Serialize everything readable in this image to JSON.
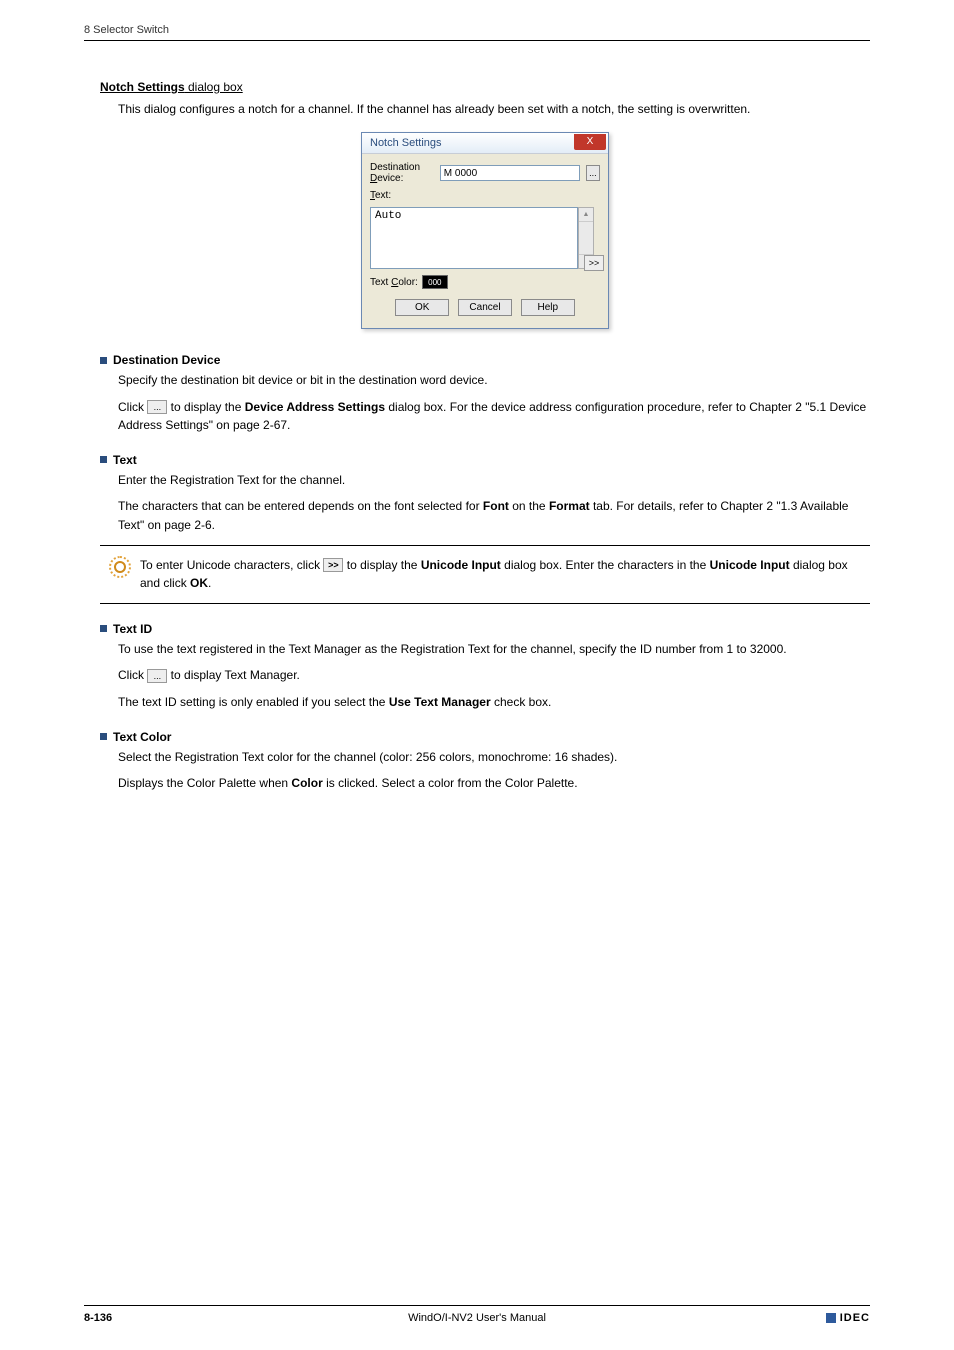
{
  "header": {
    "chapter": "8 Selector Switch"
  },
  "main_heading": {
    "bold": "Notch Settings",
    "rest": " dialog box"
  },
  "intro": "This dialog configures a notch for a channel. If the channel has already been set with a notch, the setting is overwritten.",
  "dialog": {
    "title": "Notch Settings",
    "close": "X",
    "dest_label_pre": "Destination ",
    "dest_label_uline": "D",
    "dest_label_post": "evice:",
    "dest_value": "M 0000",
    "browse": "...",
    "text_label_uline": "T",
    "text_label_post": "ext:",
    "text_value": "Auto",
    "expand": ">>",
    "textcolor_label_pre": "Text ",
    "textcolor_label_uline": "C",
    "textcolor_label_post": "olor:",
    "textcolor_swatch": "000",
    "ok": "OK",
    "cancel": "Cancel",
    "help": "Help"
  },
  "sections": {
    "dest": {
      "title": "Destination Device",
      "p1": "Specify the destination bit device or bit in the destination word device.",
      "p2a": "Click ",
      "p2btn": "...",
      "p2b": " to display the ",
      "p2bold": "Device Address Settings",
      "p2c": " dialog box. For the device address configuration procedure, refer to Chapter 2 \"5.1 Device Address Settings\" on page 2-67."
    },
    "text": {
      "title": "Text",
      "p1": "Enter the Registration Text for the channel.",
      "p2a": "The characters that can be entered depends on the font selected for ",
      "p2b1": "Font",
      "p2mid": " on the ",
      "p2b2": "Format",
      "p2c": " tab. For details, refer to Chapter 2 \"1.3 Available Text\" on page 2-6."
    },
    "tip": {
      "a": "To enter Unicode characters, click ",
      "btn": ">>",
      "b": " to display the ",
      "bold1": "Unicode Input",
      "c": " dialog box. Enter the characters in the ",
      "bold2": "Unicode Input",
      "d": " dialog box and click ",
      "bold3": "OK",
      "e": "."
    },
    "textid": {
      "title": "Text ID",
      "p1": "To use the text registered in the Text Manager as the Registration Text for the channel, specify the ID number from 1 to 32000.",
      "p2a": "Click ",
      "p2btn": "...",
      "p2b": " to display Text Manager.",
      "p3a": "The text ID setting is only enabled if you select the ",
      "p3bold": "Use Text Manager",
      "p3b": " check box."
    },
    "textcolor": {
      "title": "Text Color",
      "p1": "Select the Registration Text color for the channel (color: 256 colors, monochrome: 16 shades).",
      "p2a": "Displays the Color Palette when ",
      "p2bold": "Color",
      "p2b": " is clicked. Select a color from the Color Palette."
    }
  },
  "footer": {
    "page": "8-136",
    "center": "WindO/I-NV2 User's Manual",
    "brand": "IDEC"
  }
}
